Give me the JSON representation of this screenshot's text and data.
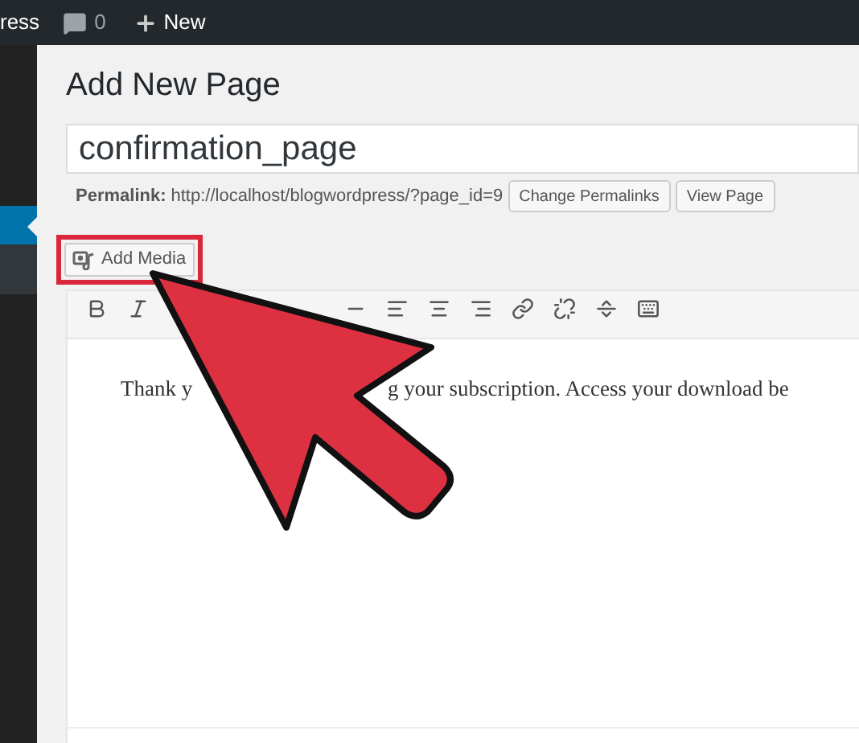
{
  "admin_bar": {
    "site_label": "ress",
    "comments_count": "0",
    "new_label": "New"
  },
  "sidebar": {
    "items": [
      {
        "selected": true
      },
      {
        "selected": false
      }
    ]
  },
  "heading": "Add New Page",
  "title_field": {
    "value": "confirmation_page"
  },
  "permalink": {
    "label": "Permalink:",
    "url": "http://localhost/blogwordpress/?page_id=9",
    "buttons": [
      "Change Permalinks",
      "View Page"
    ]
  },
  "add_media": {
    "label": "Add Media",
    "highlighted": true
  },
  "editor": {
    "text_fragments": [
      "Thank y",
      "g your subscription. Access your download be"
    ]
  }
}
